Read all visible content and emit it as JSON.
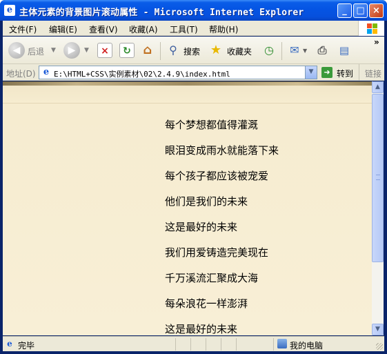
{
  "window": {
    "title": "主体元素的背景图片滚动属性 - Microsoft Internet Explorer",
    "app_icon": "ie-icon",
    "controls": {
      "minimize": "_",
      "maximize": "□",
      "close": "×"
    }
  },
  "menubar": {
    "items": [
      "文件(F)",
      "编辑(E)",
      "查看(V)",
      "收藏(A)",
      "工具(T)",
      "帮助(H)"
    ]
  },
  "toolbar": {
    "back_label": "后退",
    "search_label": "搜索",
    "favorites_label": "收藏夹",
    "chevron": "»"
  },
  "addressbar": {
    "label": "地址(D)",
    "url": "E:\\HTML+CSS\\实例素材\\02\\2.4.9\\index.html",
    "go_label": "转到",
    "links_label": "链接"
  },
  "content": {
    "lines": [
      "每个梦想都值得灌溉",
      "眼泪变成雨水就能落下来",
      "每个孩子都应该被宠爱",
      "他们是我们的未来",
      "这是最好的未来",
      "我们用爱铸造完美现在",
      "千万溪流汇聚成大海",
      "每朵浪花一样澎湃",
      "这是最好的未来"
    ]
  },
  "statusbar": {
    "status": "完毕",
    "zone": "我的电脑"
  },
  "colors": {
    "titlebar": "#0554e3",
    "chrome": "#ece9d8",
    "page_background": "#f8efd6"
  }
}
